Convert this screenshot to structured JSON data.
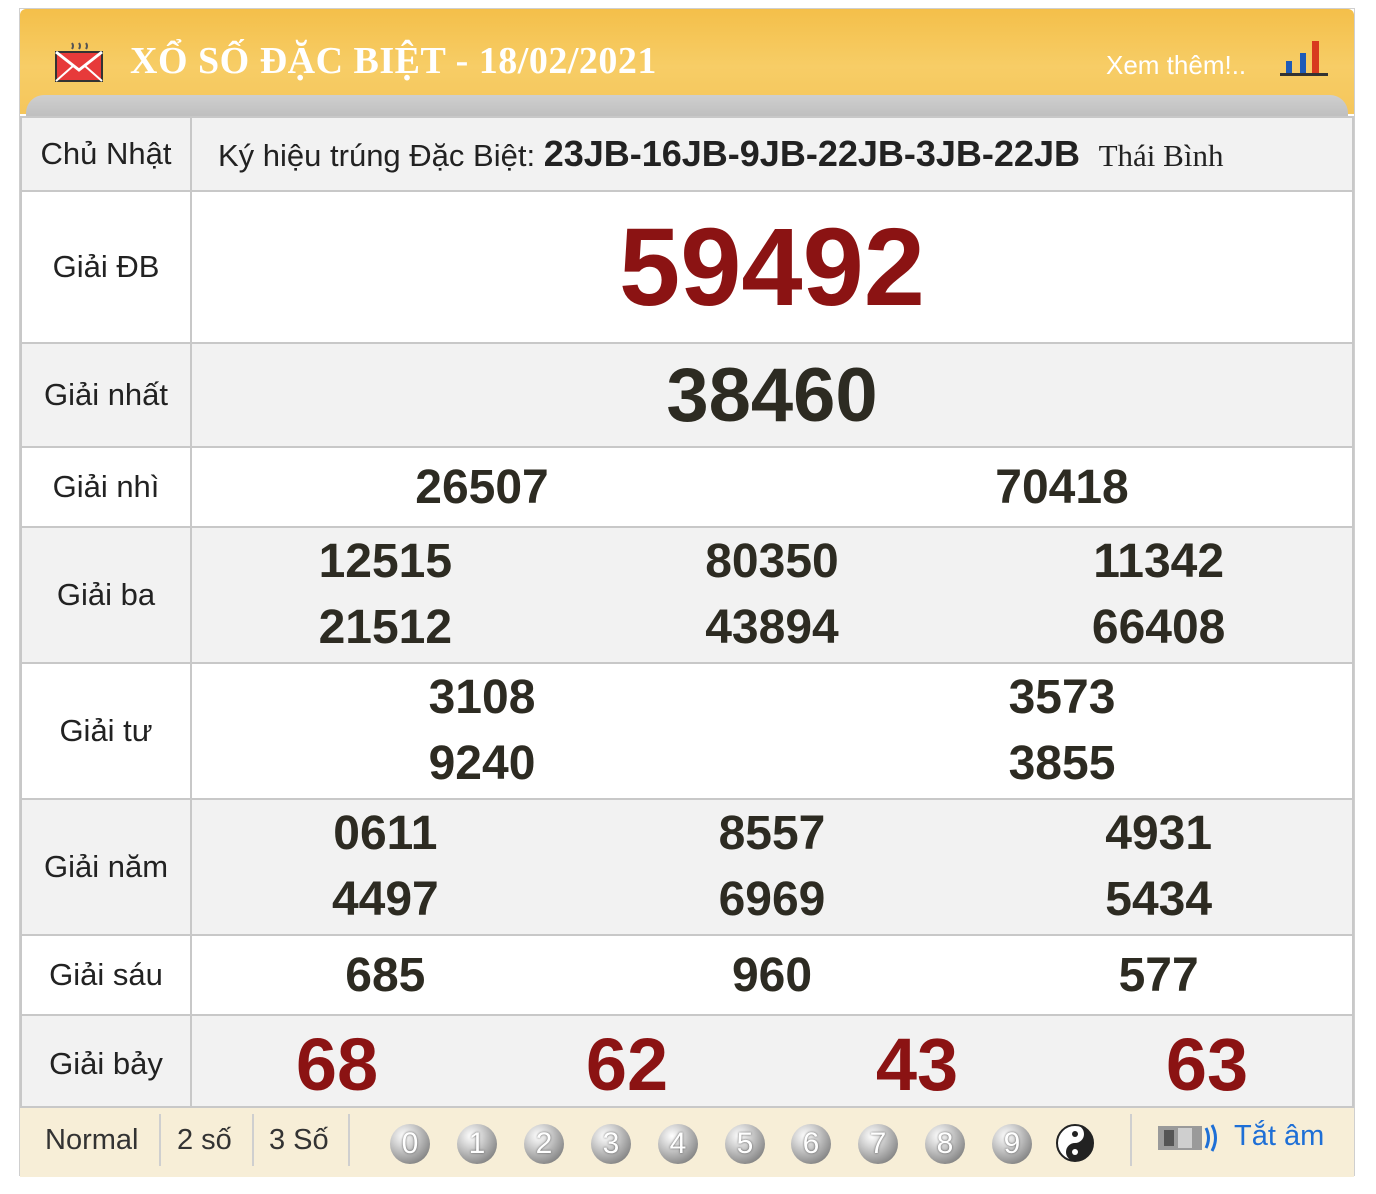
{
  "header": {
    "title": "XỔ SỐ ĐẶC BIỆT -  18/02/2021",
    "more_link": "Xem thêm!..",
    "icons": [
      "mail-icon",
      "bar-chart-icon"
    ]
  },
  "info_row": {
    "day": "Chủ Nhật",
    "symbol_label": "Ký hiệu trúng Đặc Biệt:",
    "symbols": "23JB-16JB-9JB-22JB-3JB-22JB",
    "province": "Thái Bình"
  },
  "prizes": {
    "db": {
      "label": "Giải ĐB",
      "numbers": [
        "59492"
      ]
    },
    "nhat": {
      "label": "Giải nhất",
      "numbers": [
        "38460"
      ]
    },
    "nhi": {
      "label": "Giải nhì",
      "numbers": [
        "26507",
        "70418"
      ]
    },
    "ba": {
      "label": "Giải ba",
      "numbers": [
        "12515",
        "80350",
        "11342",
        "21512",
        "43894",
        "66408"
      ]
    },
    "tu": {
      "label": "Giải tư",
      "numbers": [
        "3108",
        "3573",
        "9240",
        "3855"
      ]
    },
    "nam": {
      "label": "Giải năm",
      "numbers": [
        "0611",
        "8557",
        "4931",
        "4497",
        "6969",
        "5434"
      ]
    },
    "sau": {
      "label": "Giải sáu",
      "numbers": [
        "685",
        "960",
        "577"
      ]
    },
    "bay": {
      "label": "Giải bảy",
      "numbers": [
        "68",
        "62",
        "43",
        "63"
      ]
    }
  },
  "colors": {
    "header": "#f5c55a",
    "special_red": "#8b1313",
    "number_dark": "#2d2b22",
    "footer": "#f7eed7",
    "link_blue": "#1e6fd6"
  },
  "footer": {
    "tabs": [
      "Normal",
      "2 số",
      "3 Số"
    ],
    "digits": [
      "0",
      "1",
      "2",
      "3",
      "4",
      "5",
      "6",
      "7",
      "8",
      "9"
    ],
    "yin_yang": "yin-yang-icon",
    "mute_label": "Tắt âm"
  }
}
